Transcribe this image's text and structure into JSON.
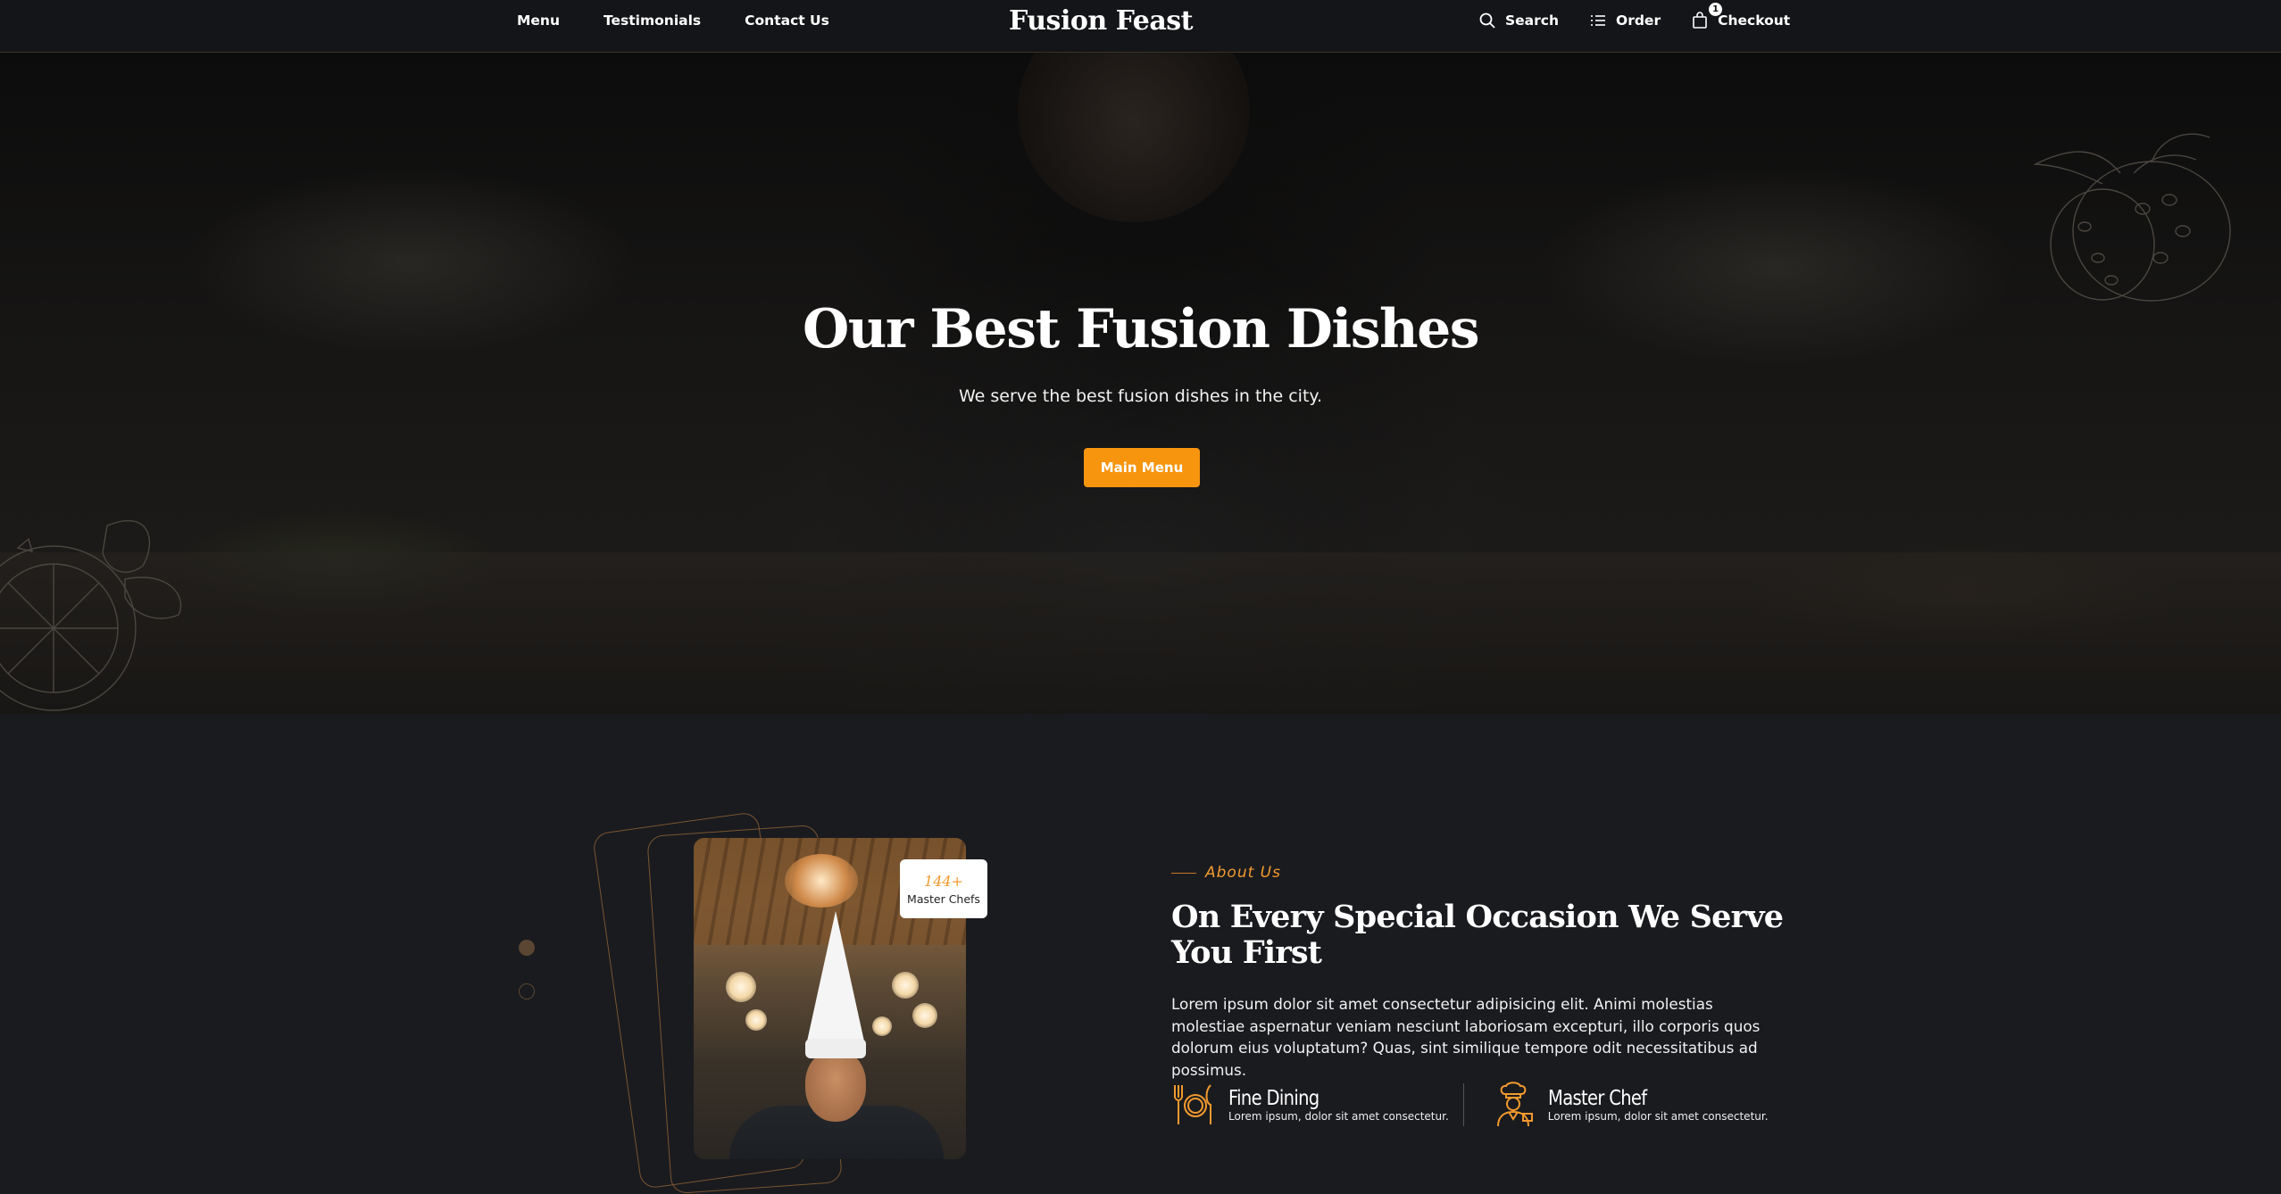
{
  "header": {
    "nav": [
      "Menu",
      "Testimonials",
      "Contact Us"
    ],
    "brand": "Fusion Feast",
    "actions": {
      "search": "Search",
      "order": "Order",
      "checkout": "Checkout",
      "cart_count": "1"
    }
  },
  "hero": {
    "title": "Our Best Fusion Dishes",
    "subtitle": "We serve the best fusion dishes in the city.",
    "button": "Main Menu"
  },
  "about": {
    "badge_number": "144+",
    "badge_label": "Master Chefs",
    "kicker": "About Us",
    "heading": "On Every Special Occasion We Serve You First",
    "body": "Lorem ipsum dolor sit amet consectetur adipisicing elit. Animi molestias molestiae aspernatur veniam nesciunt laboriosam excepturi, illo corporis quos dolorum eius voluptatum? Quas, sint similique tempore odit necessitatibus ad possimus.",
    "features": [
      {
        "title": "Fine Dining",
        "desc": "Lorem ipsum, dolor sit amet consectetur.",
        "icon": "utensils-plate-icon"
      },
      {
        "title": "Master Chef",
        "desc": "Lorem ipsum, dolor sit amet consectetur.",
        "icon": "chef-icon"
      }
    ]
  },
  "colors": {
    "accent": "#f7950f",
    "background": "#1a1b1f",
    "header": "#141518"
  }
}
